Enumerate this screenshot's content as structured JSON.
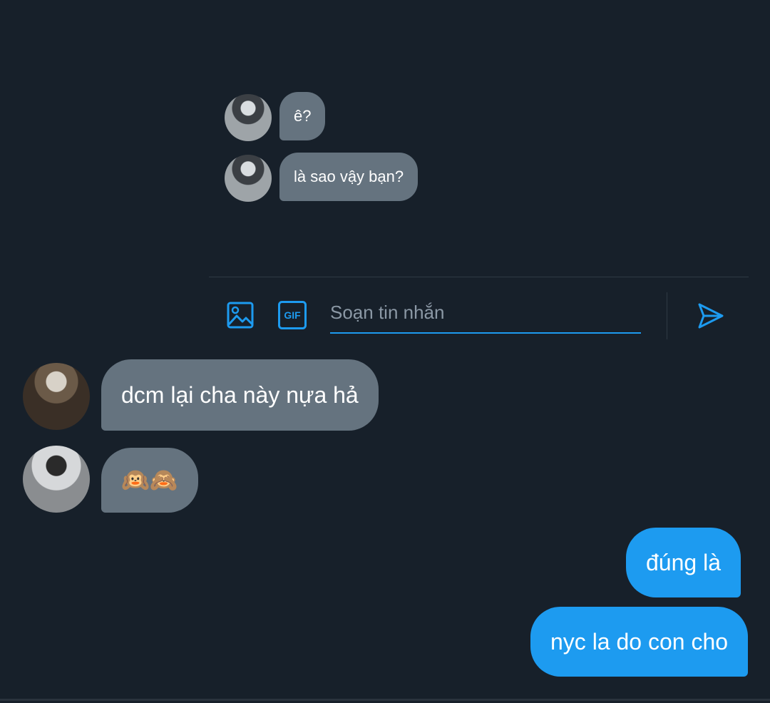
{
  "embedded_conversation": {
    "messages": [
      {
        "text": "ê?",
        "avatar": "avatar-icon"
      },
      {
        "text": "là sao vậy bạn?",
        "avatar": "avatar-icon"
      }
    ]
  },
  "composer": {
    "placeholder": "Soạn tin nhắn",
    "gif_label": "GIF",
    "icons": [
      "image-icon",
      "gif-icon",
      "send-icon"
    ]
  },
  "messages": [
    {
      "text": "dcm lại cha này nựa hả",
      "direction": "incoming"
    },
    {
      "text": "🙉🙈",
      "direction": "incoming"
    },
    {
      "text": "đúng là",
      "direction": "outgoing"
    },
    {
      "text": "nyc la do con cho",
      "direction": "outgoing"
    }
  ],
  "colors": {
    "background": "#17202a",
    "incoming_bubble": "#65737f",
    "outgoing_bubble": "#1d9bf0",
    "accent": "#1d9bf0"
  }
}
